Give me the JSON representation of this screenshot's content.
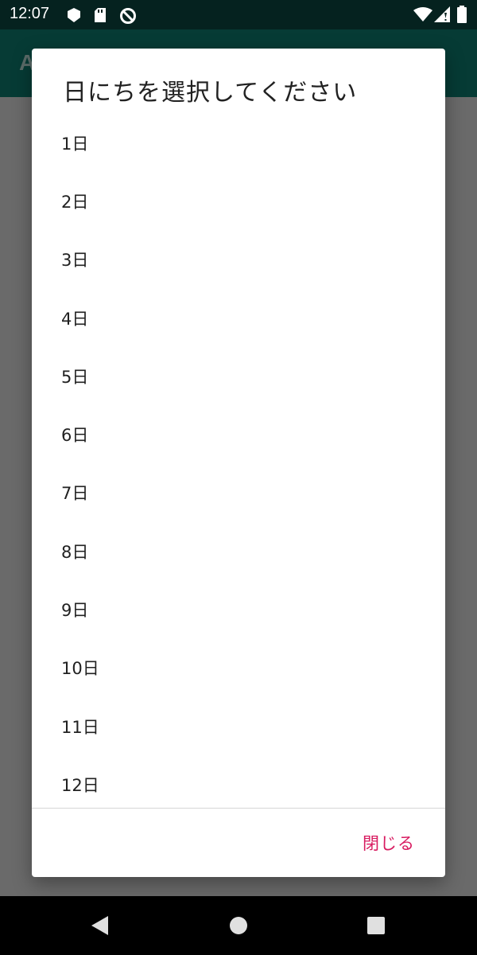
{
  "status_bar": {
    "time": "12:07",
    "icons": [
      "shield-icon",
      "sd-card-icon",
      "no-sign-icon",
      "wifi-icon",
      "cell-signal-icon",
      "battery-icon"
    ]
  },
  "app_bar": {
    "title_fragment": "A"
  },
  "dialog": {
    "title": "日にちを選択してください",
    "items": [
      {
        "label": "1日"
      },
      {
        "label": "2日"
      },
      {
        "label": "3日"
      },
      {
        "label": "4日"
      },
      {
        "label": "5日"
      },
      {
        "label": "6日"
      },
      {
        "label": "7日"
      },
      {
        "label": "8日"
      },
      {
        "label": "9日"
      },
      {
        "label": "10日"
      },
      {
        "label": "11日"
      },
      {
        "label": "12日"
      }
    ],
    "close_label": "閉じる"
  },
  "nav_bar": {
    "buttons": [
      "back-icon",
      "home-icon",
      "recents-icon"
    ]
  },
  "colors": {
    "accent": "#d81b60",
    "app_bar": "#063b35",
    "status_bar": "#05221f"
  }
}
